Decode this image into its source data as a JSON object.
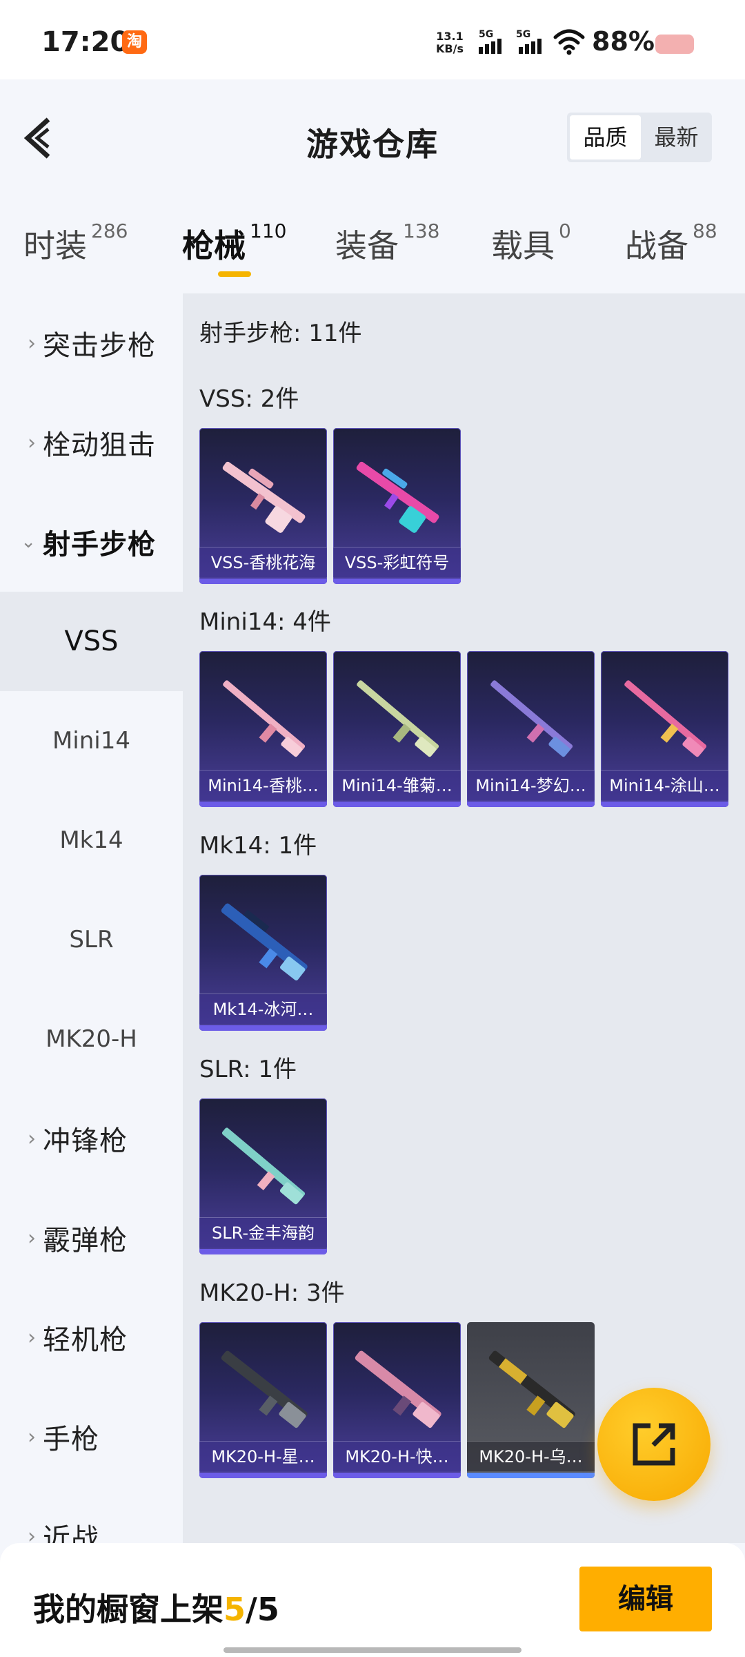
{
  "status_bar": {
    "time": "17:20",
    "app_badge": "淘",
    "net_speed": "13.1",
    "net_unit": "KB/s",
    "sim1": "5G",
    "sim2": "5G",
    "battery": "88%"
  },
  "header": {
    "title": "游戏仓库",
    "sort_quality": "品质",
    "sort_newest": "最新"
  },
  "tabs": [
    {
      "label": "时装",
      "count": "286"
    },
    {
      "label": "枪械",
      "count": "110"
    },
    {
      "label": "装备",
      "count": "138"
    },
    {
      "label": "载具",
      "count": "0"
    },
    {
      "label": "战备",
      "count": "88"
    }
  ],
  "sidebar": {
    "categories": [
      {
        "label": "突击步枪"
      },
      {
        "label": "栓动狙击"
      },
      {
        "label": "射手步枪"
      }
    ],
    "subitems": [
      {
        "label": "VSS"
      },
      {
        "label": "Mini14"
      },
      {
        "label": "Mk14"
      },
      {
        "label": "SLR"
      },
      {
        "label": "MK20-H"
      }
    ],
    "more_categories": [
      {
        "label": "冲锋枪"
      },
      {
        "label": "霰弹枪"
      },
      {
        "label": "轻机枪"
      },
      {
        "label": "手枪"
      },
      {
        "label": "近战"
      }
    ]
  },
  "content": {
    "section_title": "射手步枪: 11件",
    "groups": [
      {
        "title": "VSS: 2件",
        "items": [
          "VSS-香桃花海",
          "VSS-彩虹符号"
        ]
      },
      {
        "title": "Mini14: 4件",
        "items": [
          "Mini14-香桃…",
          "Mini14-雏菊…",
          "Mini14-梦幻…",
          "Mini14-涂山…"
        ]
      },
      {
        "title": "Mk14: 1件",
        "items": [
          "Mk14-冰河…"
        ]
      },
      {
        "title": "SLR: 1件",
        "items": [
          "SLR-金丰海韵"
        ]
      },
      {
        "title": "MK20-H: 3件",
        "items": [
          "MK20-H-星…",
          "MK20-H-快…",
          "MK20-H-乌…"
        ]
      }
    ]
  },
  "bottom": {
    "shelf_label": "我的橱窗上架",
    "shelf_used": "5",
    "shelf_sep": "/",
    "shelf_total": "5",
    "edit_label": "编辑"
  },
  "colors": {
    "accent": "#f5b400",
    "card_purple": "#4b3f9a",
    "edit_button": "#ffae00"
  }
}
